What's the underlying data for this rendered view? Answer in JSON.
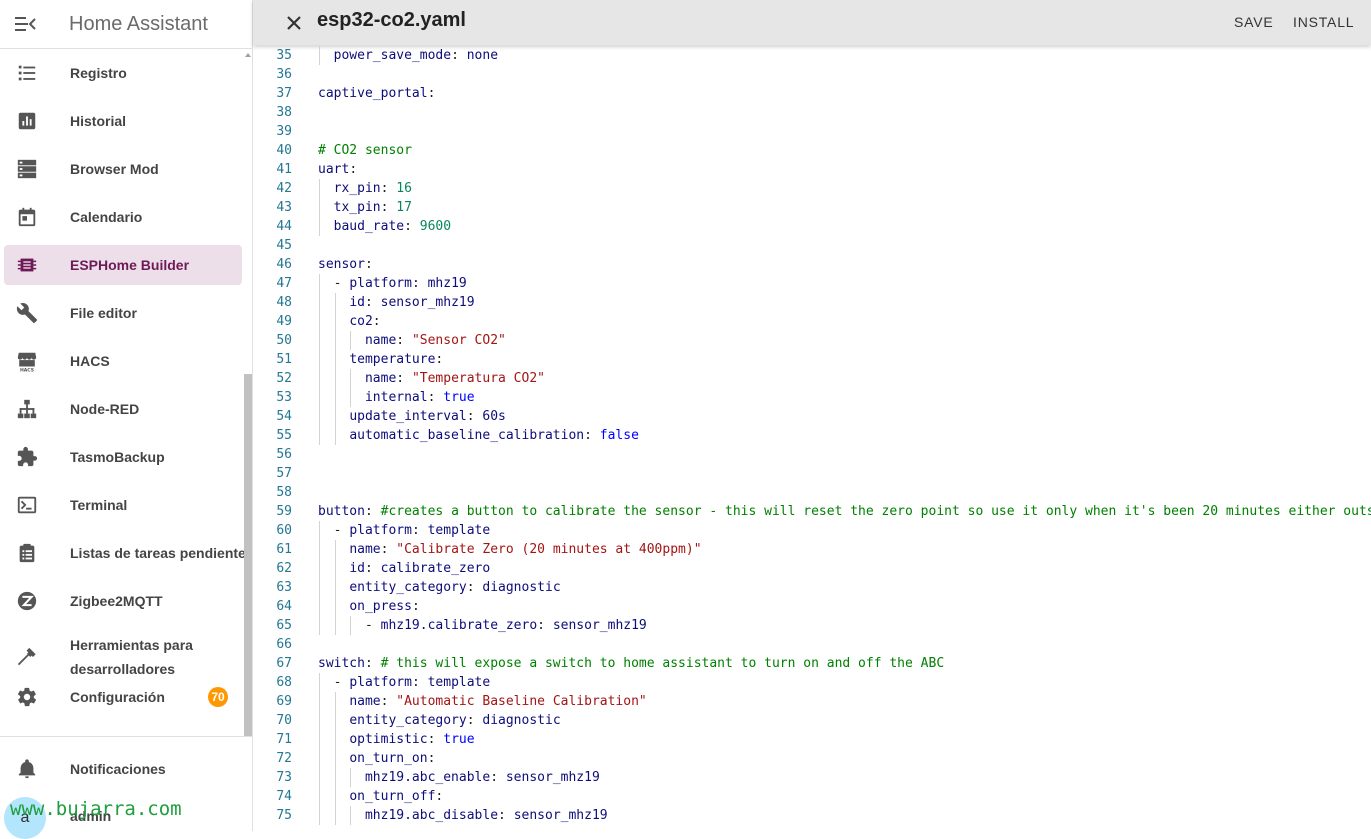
{
  "sidebar": {
    "title": "Home Assistant",
    "items": [
      {
        "label": "Registro",
        "icon": "list-icon"
      },
      {
        "label": "Historial",
        "icon": "chart-box-icon"
      },
      {
        "label": "Browser Mod",
        "icon": "server-icon"
      },
      {
        "label": "Calendario",
        "icon": "calendar-icon"
      },
      {
        "label": "ESPHome Builder",
        "icon": "chip-icon",
        "active": true
      },
      {
        "label": "File editor",
        "icon": "wrench-icon"
      },
      {
        "label": "HACS",
        "icon": "hacs-store-icon"
      },
      {
        "label": "Node-RED",
        "icon": "sitemap-icon"
      },
      {
        "label": "TasmoBackup",
        "icon": "puzzle-icon"
      },
      {
        "label": "Terminal",
        "icon": "console-icon"
      },
      {
        "label": "Listas de tareas pendientes",
        "icon": "clipboard-list-icon"
      },
      {
        "label": "Zigbee2MQTT",
        "icon": "zigbee-icon"
      },
      {
        "label": "Herramientas para desarrolladores",
        "icon": "hammer-icon"
      },
      {
        "label": "Configuración",
        "icon": "cog-icon",
        "badge": "70"
      }
    ],
    "notifications": {
      "label": "Notificaciones",
      "icon": "bell-icon"
    },
    "user": {
      "avatar_letter": "a",
      "name": "admin"
    },
    "watermark": "www.bujarra.com"
  },
  "editor": {
    "filename": "esp32-co2.yaml",
    "save_label": "SAVE",
    "install_label": "INSTALL",
    "lines": [
      {
        "n": "35",
        "t": "  power_save_mode: none"
      },
      {
        "n": "36",
        "t": ""
      },
      {
        "n": "37",
        "t": "captive_portal:"
      },
      {
        "n": "38",
        "t": ""
      },
      {
        "n": "39",
        "t": ""
      },
      {
        "n": "40",
        "t": "# CO2 sensor"
      },
      {
        "n": "41",
        "t": "uart:"
      },
      {
        "n": "42",
        "t": "  rx_pin: 16"
      },
      {
        "n": "43",
        "t": "  tx_pin: 17"
      },
      {
        "n": "44",
        "t": "  baud_rate: 9600"
      },
      {
        "n": "45",
        "t": ""
      },
      {
        "n": "46",
        "t": "sensor:"
      },
      {
        "n": "47",
        "t": "  - platform: mhz19"
      },
      {
        "n": "48",
        "t": "    id: sensor_mhz19"
      },
      {
        "n": "49",
        "t": "    co2:"
      },
      {
        "n": "50",
        "t": "      name: \"Sensor CO2\""
      },
      {
        "n": "51",
        "t": "    temperature:"
      },
      {
        "n": "52",
        "t": "      name: \"Temperatura CO2\""
      },
      {
        "n": "53",
        "t": "      internal: true"
      },
      {
        "n": "54",
        "t": "    update_interval: 60s"
      },
      {
        "n": "55",
        "t": "    automatic_baseline_calibration: false"
      },
      {
        "n": "56",
        "t": ""
      },
      {
        "n": "57",
        "t": ""
      },
      {
        "n": "58",
        "t": ""
      },
      {
        "n": "59",
        "t": "button: #creates a button to calibrate the sensor - this will reset the zero point so use it only when it's been 20 minutes either outsid"
      },
      {
        "n": "60",
        "t": "  - platform: template"
      },
      {
        "n": "61",
        "t": "    name: \"Calibrate Zero (20 minutes at 400ppm)\""
      },
      {
        "n": "62",
        "t": "    id: calibrate_zero"
      },
      {
        "n": "63",
        "t": "    entity_category: diagnostic"
      },
      {
        "n": "64",
        "t": "    on_press:"
      },
      {
        "n": "65",
        "t": "      - mhz19.calibrate_zero: sensor_mhz19"
      },
      {
        "n": "66",
        "t": ""
      },
      {
        "n": "67",
        "t": "switch: # this will expose a switch to home assistant to turn on and off the ABC"
      },
      {
        "n": "68",
        "t": "  - platform: template"
      },
      {
        "n": "69",
        "t": "    name: \"Automatic Baseline Calibration\""
      },
      {
        "n": "70",
        "t": "    entity_category: diagnostic"
      },
      {
        "n": "71",
        "t": "    optimistic: true"
      },
      {
        "n": "72",
        "t": "    on_turn_on:"
      },
      {
        "n": "73",
        "t": "      mhz19.abc_enable: sensor_mhz19"
      },
      {
        "n": "74",
        "t": "    on_turn_off:"
      },
      {
        "n": "75",
        "t": "      mhz19.abc_disable: sensor_mhz19"
      }
    ]
  },
  "colors": {
    "active_bg": "#eddfea",
    "active_text": "#6e1a56",
    "badge": "#ff9800",
    "line_number": "#237893",
    "key": "#0d0d7a",
    "number": "#098658",
    "string": "#a31515",
    "comment": "#008000",
    "boolean": "#0000ff"
  }
}
